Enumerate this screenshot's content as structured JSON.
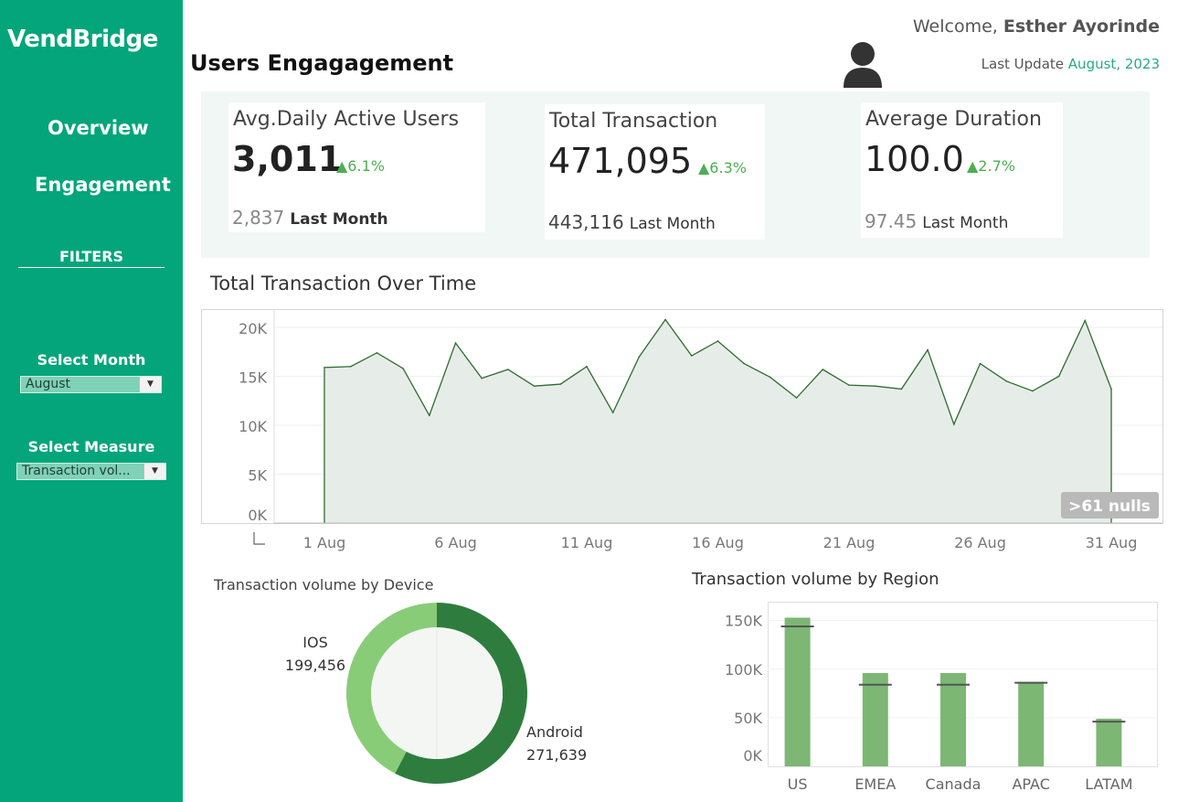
{
  "app": {
    "name": "VendBridge"
  },
  "sidebar": {
    "nav": [
      {
        "label": "Overview"
      },
      {
        "label": "Engagement"
      }
    ],
    "filters_title": "FILTERS",
    "month_filter": {
      "label": "Select Month",
      "value": "August"
    },
    "measure_filter": {
      "label": "Select Measure",
      "value": "Transaction vol..."
    }
  },
  "header": {
    "title": "Users Engagagement",
    "welcome_prefix": "Welcome,",
    "user_name": "Esther Ayorinde",
    "last_update_label": "Last Update",
    "last_update_value": "August, 2023"
  },
  "kpis": [
    {
      "title": "Avg.Daily Active Users",
      "value": "3,011",
      "change": "▲6.1%",
      "previous": "2,837",
      "previous_label": "Last Month"
    },
    {
      "title": "Total Transaction",
      "value": "471,095",
      "change": "▲6.3%",
      "previous": "443,116",
      "previous_label": "Last Month"
    },
    {
      "title": "Average Duration",
      "value": "100.0",
      "change": "▲2.7%",
      "previous": "97.45",
      "previous_label": "Last Month"
    }
  ],
  "colors": {
    "sidebar": "#04a57a",
    "accent": "#2aa886",
    "positive": "#4caf50",
    "line": "#2e6b2e",
    "area": "#e6ede8",
    "bar": "#7cb774",
    "donut_dark": "#2e7d3e",
    "donut_light": "#88cc78"
  },
  "chart_data": [
    {
      "type": "area",
      "title": "Total Transaction Over Time",
      "xlabel": "",
      "ylabel": "",
      "x_tick_labels": [
        "1 Aug",
        "6 Aug",
        "11 Aug",
        "16 Aug",
        "21 Aug",
        "26 Aug",
        "31 Aug"
      ],
      "y_tick_labels": [
        "20K",
        "15K",
        "10K",
        "5K",
        "0K"
      ],
      "ylim": [
        0,
        21000
      ],
      "grid": true,
      "annotation": ">61 nulls",
      "x": [
        1,
        2,
        3,
        4,
        5,
        6,
        7,
        8,
        9,
        10,
        11,
        12,
        13,
        14,
        15,
        16,
        17,
        18,
        19,
        20,
        21,
        22,
        23,
        24,
        25,
        26,
        27,
        28,
        29,
        30,
        31
      ],
      "values": [
        15900,
        16000,
        17400,
        15800,
        11000,
        18400,
        14800,
        15700,
        14000,
        14200,
        16000,
        11300,
        17000,
        20800,
        17100,
        18600,
        16300,
        14900,
        12800,
        15700,
        14100,
        14000,
        13700,
        17700,
        10100,
        16300,
        14500,
        13500,
        15000,
        20700,
        13700
      ]
    },
    {
      "type": "pie",
      "title": "Transaction volume by Device",
      "labels": [
        "Android",
        "IOS"
      ],
      "values": [
        271639,
        199456
      ],
      "value_labels": [
        "271,639",
        "199,456"
      ]
    },
    {
      "type": "bar",
      "title": "Transaction volume by Region",
      "categories": [
        "US",
        "EMEA",
        "Canada",
        "APAC",
        "LATAM"
      ],
      "values": [
        153000,
        96000,
        96000,
        87000,
        49000
      ],
      "reference_values": [
        144000,
        84000,
        84000,
        86000,
        46000
      ],
      "y_tick_labels": [
        "150K",
        "100K",
        "50K",
        "0K"
      ],
      "ylim": [
        0,
        160000
      ],
      "grid": true
    }
  ]
}
